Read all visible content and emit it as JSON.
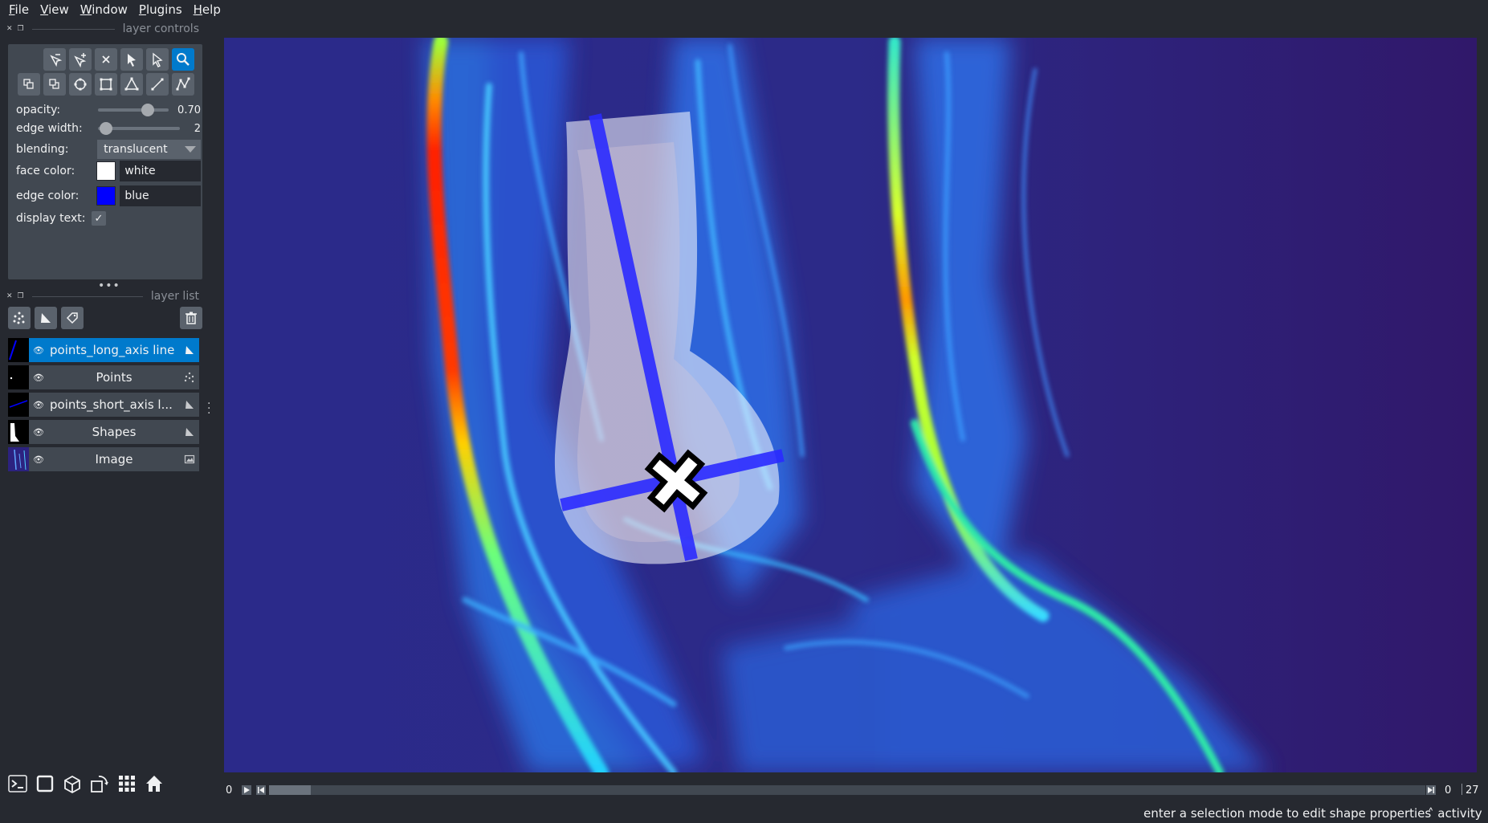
{
  "menu": [
    "File",
    "View",
    "Window",
    "Plugins",
    "Help"
  ],
  "dock": {
    "controls_title": "layer controls",
    "list_title": "layer list"
  },
  "controls": {
    "opacity_label": "opacity:",
    "opacity_value": "0.70",
    "opacity_fraction": 0.7,
    "edge_width_label": "edge width:",
    "edge_width_value": "2",
    "edge_width_fraction": 0.1,
    "blending_label": "blending:",
    "blending_value": "translucent",
    "face_color_label": "face color:",
    "face_color_value": "white",
    "face_color_hex": "#ffffff",
    "edge_color_label": "edge color:",
    "edge_color_value": "blue",
    "edge_color_hex": "#0000ff",
    "display_text_label": "display text:",
    "display_text_checked": true
  },
  "tools_row1": [
    "remove-last-icon",
    "add-vertex-icon",
    "delete-icon",
    "select-icon",
    "direct-select-icon",
    "zoom-icon"
  ],
  "tools_row2": [
    "move-back-icon",
    "move-front-icon",
    "ellipse-icon",
    "rectangle-icon",
    "polygon-icon",
    "line-icon",
    "path-icon"
  ],
  "layers": [
    {
      "name": "points_long_axis line",
      "type": "shapes",
      "selected": true
    },
    {
      "name": "Points",
      "type": "points",
      "selected": false
    },
    {
      "name": "points_short_axis l...",
      "type": "shapes",
      "selected": false
    },
    {
      "name": "Shapes",
      "type": "shapes",
      "selected": false
    },
    {
      "name": "Image",
      "type": "image",
      "selected": false
    }
  ],
  "dims": {
    "start": "0",
    "current": "0",
    "total": "27"
  },
  "status": {
    "message": "enter a selection mode to edit shape properties",
    "activity": "activity"
  }
}
